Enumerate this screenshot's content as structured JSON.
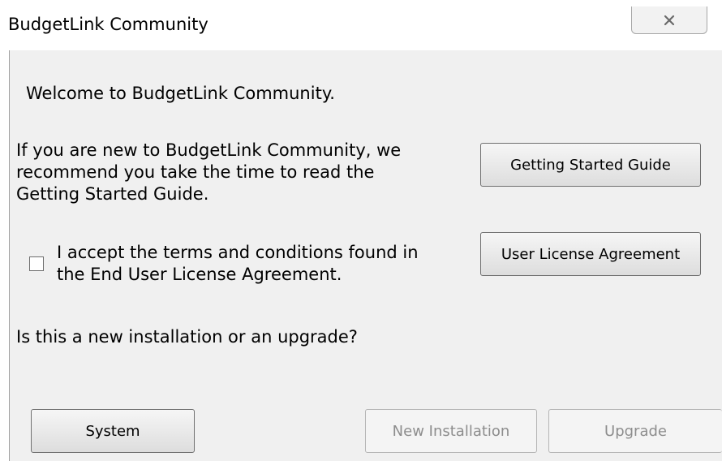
{
  "window": {
    "title": "BudgetLink Community",
    "close_icon": "close-icon"
  },
  "content": {
    "welcome": "Welcome to BudgetLink Community.",
    "guide_text_lines": [
      "If you are new to BudgetLink Community, we",
      "recommend you take the time to read the",
      "Getting Started Guide."
    ],
    "terms_lines": [
      "I accept the terms and conditions found in",
      "the End User License Agreement."
    ],
    "terms_checked": false,
    "install_question": "Is this a new installation or an upgrade?"
  },
  "buttons": {
    "getting_started": "Getting Started Guide",
    "license": "User License Agreement",
    "system": "System",
    "new_installation": "New Installation",
    "upgrade": "Upgrade"
  },
  "colors": {
    "background": "#f0f0f0",
    "disabled_text": "#8d8d8d"
  }
}
